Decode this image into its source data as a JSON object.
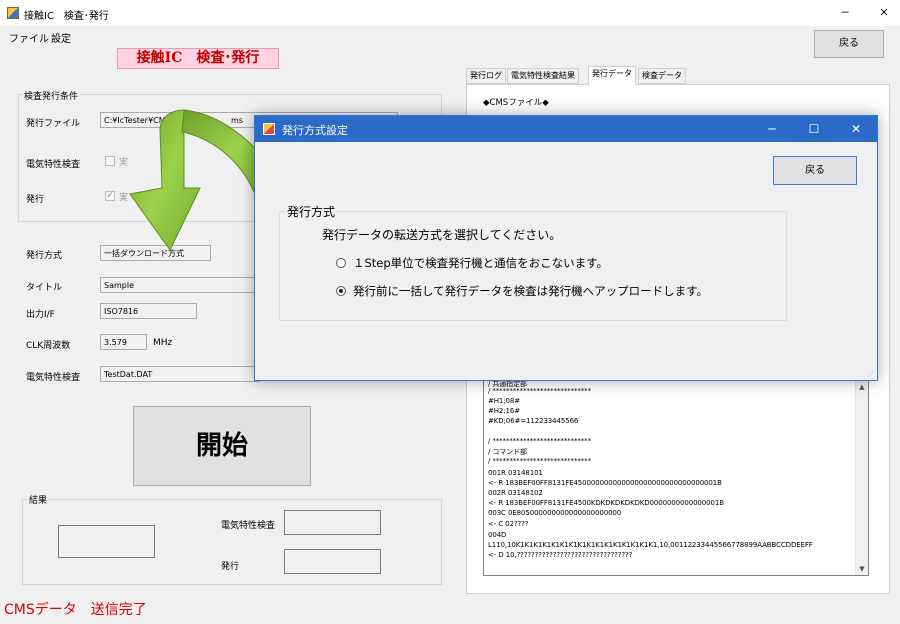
{
  "window": {
    "title": "接触IC　検査･発行",
    "controls": {
      "minimize": "─",
      "maximize": "☐",
      "close": "✕"
    }
  },
  "menu": {
    "items": [
      "ファイル",
      "設定"
    ]
  },
  "toolbar": {
    "back_label": "戻る"
  },
  "page_title": "接触IC　検査･発行",
  "conditions": {
    "group_label": "検査発行条件",
    "issue_file_label": "発行ファイル",
    "issue_file_value": "C:¥IcTester¥CMS¥D",
    "issue_file_suffix": "ms",
    "elec_test_label": "電気特性検査",
    "elec_test_check_label": "実",
    "issue_label": "発行",
    "issue_check_label": "実"
  },
  "settings": {
    "method_label": "発行方式",
    "method_value": "一括ダウンロード方式",
    "title_label": "タイトル",
    "title_value": "Sample",
    "output_label": "出力I/F",
    "output_value": "ISO7816",
    "clk_label": "CLK周波数",
    "clk_value": "3.579",
    "clk_unit": "MHz",
    "elec_label": "電気特性検査",
    "elec_value": "TestDat.DAT"
  },
  "start_button": "開始",
  "result": {
    "group_label": "結果",
    "elec_label": "電気特性検査",
    "issue_label": "発行"
  },
  "status_text": "CMSデータ　送信完了",
  "tabs": [
    {
      "label": "発行ログ"
    },
    {
      "label": "電気特性検査結果"
    },
    {
      "label": "発行データ"
    },
    {
      "label": "検査データ"
    }
  ],
  "tab_panel": {
    "header": "◆CMSファイル◆",
    "log_lines": [
      "/ 共通指定部",
      "/ *****************************",
      "#H1;08#",
      "#H2;16#",
      "#KD;06#=112233445566",
      "",
      "/ *****************************",
      "/ コマンド部",
      "/ *****************************",
      "001R  03148101",
      "<- R  183BEF00FF8131FE450000000000000000000000000000001B",
      "002R  03148102",
      "<- R  183BEF00FF8131FE4500KDKDKDKDKDKD0000000000000001B",
      "003C  0E805000000000000000000000",
      "<- C  02????",
      "004D",
      "L110,10K1K1K1K1K1K1K1K1K1K1K1K1K1K1K1K1,10,00112233445566778899AABBCCDDEEFF",
      "<- D  10,????????????????????????????????"
    ]
  },
  "dialog": {
    "title": "発行方式設定",
    "controls": {
      "minimize": "─",
      "maximize": "☐",
      "close": "✕"
    },
    "back_label": "戻る",
    "group_label": "発行方式",
    "instruction": "発行データの転送方式を選択してください。",
    "options": [
      {
        "label": "１Step単位で検査発行機と通信をおこないます。",
        "selected": false
      },
      {
        "label": "発行前に一括して発行データを検査は発行機へアップロードします。",
        "selected": true
      }
    ]
  },
  "colors": {
    "accent": "#2b6bc7",
    "title_red": "#c00000",
    "title_bg": "#ffd3e0",
    "status_red": "#e00000",
    "arrow_green": "#8cc63f"
  },
  "icons": {
    "app": "app-icon",
    "arrow": "curved-arrow-icon",
    "scroll_up": "chevron-up-icon",
    "scroll_down": "chevron-down-icon"
  }
}
